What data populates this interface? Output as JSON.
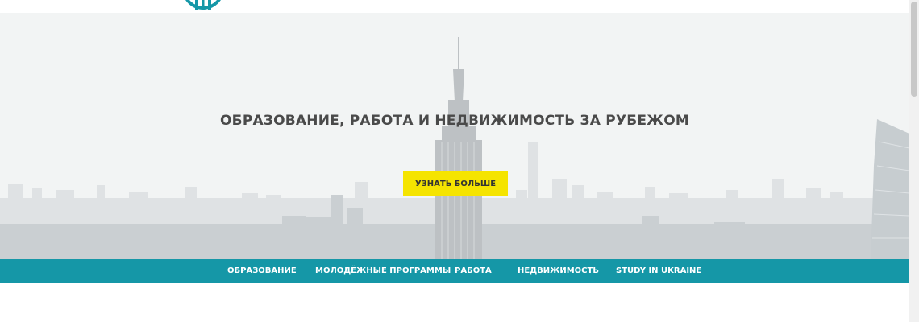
{
  "hero": {
    "title": "ОБРАЗОВАНИЕ, РАБОТА И НЕДВИЖИМОСТЬ ЗА РУБЕЖОМ",
    "cta_label": "УЗНАТЬ БОЛЬШЕ"
  },
  "nav": {
    "items": [
      {
        "label": "ОБРАЗОВАНИЕ"
      },
      {
        "label": "МОЛОДЁЖНЫЕ ПРОГРАММЫ"
      },
      {
        "label": "РАБОТА"
      },
      {
        "label": "НЕДВИЖИМОСТЬ"
      },
      {
        "label": "STUDY IN UKRAINE"
      }
    ]
  },
  "colors": {
    "accent": "#1597a7",
    "button": "#f5e400",
    "title": "#4a4a4a"
  }
}
